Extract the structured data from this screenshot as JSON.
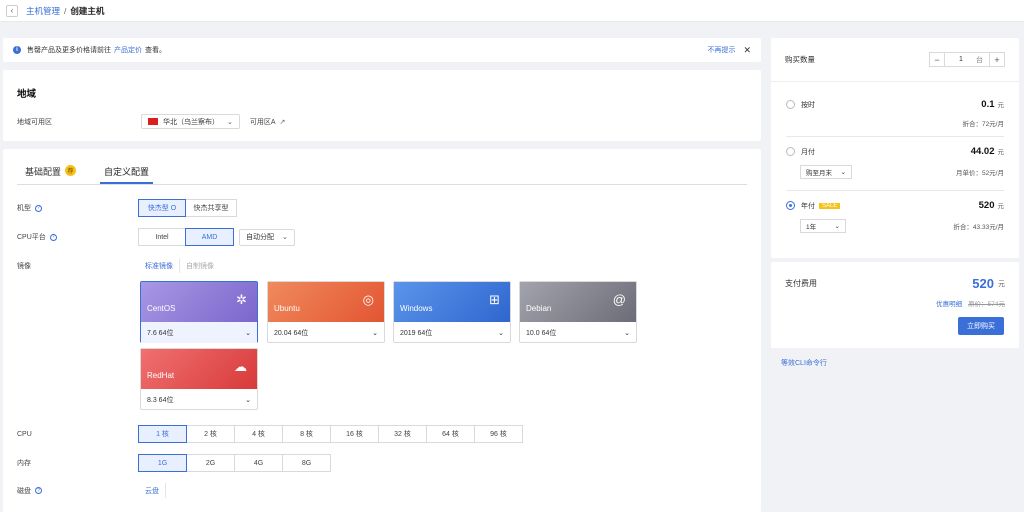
{
  "breadcrumb": {
    "parent": "主机管理",
    "separator": "/",
    "current": "创建主机"
  },
  "notice": {
    "text": "售罄产品及更多价格请前往",
    "link": "产品定价",
    "suffix": "查看。",
    "dismiss": "不再提示"
  },
  "region": {
    "title": "地域",
    "label": "地域可用区",
    "selected": "华北（乌兰察布）",
    "zone": "可用区A"
  },
  "tabs": [
    {
      "label": "基础配置",
      "badge": "荐"
    },
    {
      "label": "自定义配置"
    }
  ],
  "model": {
    "label": "机型",
    "options": [
      "快杰型 O",
      "快杰共享型"
    ],
    "active": 0
  },
  "cpu_platform": {
    "label": "CPU平台",
    "options": [
      "Intel",
      "AMD"
    ],
    "active": 1,
    "dropdown": "自动分配"
  },
  "image": {
    "label": "镜像",
    "tabs": [
      "标准镜像",
      "自制镜像"
    ]
  },
  "os": [
    {
      "name": "CentOS",
      "version": "7.6 64位",
      "color": "#8d7ad6",
      "logo": "✲"
    },
    {
      "name": "Ubuntu",
      "version": "20.04 64位",
      "color": "#e9603a",
      "logo": "◎"
    },
    {
      "name": "Windows",
      "version": "2019 64位",
      "color": "#3b78d8",
      "logo": "⊞"
    },
    {
      "name": "Debian",
      "version": "10.0 64位",
      "color": "#7d7d8a",
      "logo": "@"
    },
    {
      "name": "RedHat",
      "version": "8.3 64位",
      "color": "#e04848",
      "logo": "☁"
    }
  ],
  "cpu": {
    "label": "CPU",
    "options": [
      "1 核",
      "2 核",
      "4 核",
      "8 核",
      "16 核",
      "32 核",
      "64 核",
      "96 核"
    ],
    "active": 0
  },
  "memory": {
    "label": "内存",
    "options": [
      "1G",
      "2G",
      "4G",
      "8G"
    ],
    "active": 0
  },
  "disk": {
    "label": "磁盘",
    "tab": "云盘"
  },
  "purchase": {
    "qty_label": "购买数量",
    "qty": "1",
    "unit": "台",
    "plans": [
      {
        "name": "按时",
        "price": "0.1",
        "yuan": "元",
        "note": "折合：72元/月"
      },
      {
        "name": "月付",
        "price": "44.02",
        "yuan": "元",
        "select": "购至月末",
        "note": "月单价：52元/月"
      },
      {
        "name": "年付",
        "badge": "SALE",
        "price": "520",
        "yuan": "元",
        "select": "1年",
        "note": "折合：43.33元/月"
      }
    ]
  },
  "payment": {
    "label": "支付费用",
    "price": "520",
    "yuan": "元",
    "discount": "优惠明细",
    "original": "原价：574元",
    "buy": "立即购买"
  },
  "cli": "等效CLI命令行"
}
